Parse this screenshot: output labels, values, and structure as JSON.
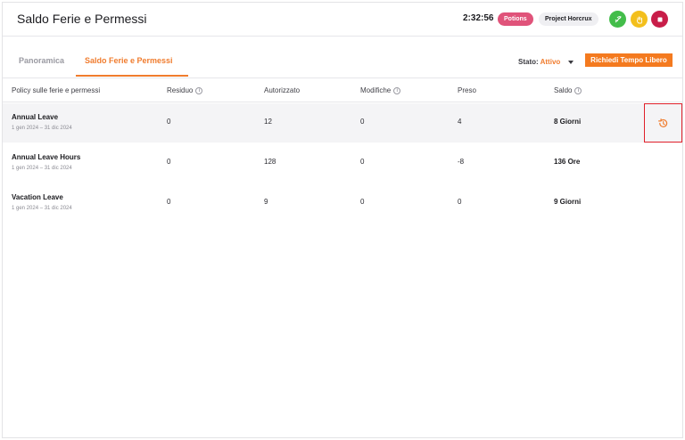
{
  "header": {
    "title": "Saldo Ferie e Permessi",
    "timer": "2:32:56",
    "badge_potions": "Potions",
    "badge_project": "Project Horcrux"
  },
  "tabs": [
    {
      "label": "Panoramica"
    },
    {
      "label": "Saldo Ferie e Permessi"
    }
  ],
  "filters": {
    "stato_label": "Stato:",
    "stato_value": "Attivo",
    "request_button": "Richiedi Tempo Libero"
  },
  "table": {
    "columns": [
      "Policy sulle ferie e permessi",
      "Residuo",
      "Autorizzato",
      "Modifiche",
      "Preso",
      "Saldo"
    ],
    "info_symbol": "i",
    "rows": [
      {
        "name": "Annual Leave",
        "dates": "1 gen 2024 – 31 dic 2024",
        "residuo": "0",
        "autorizzato": "12",
        "modifiche": "0",
        "preso": "4",
        "saldo": "8 Giorni"
      },
      {
        "name": "Annual Leave Hours",
        "dates": "1 gen 2024 – 31 dic 2024",
        "residuo": "0",
        "autorizzato": "128",
        "modifiche": "0",
        "preso": "-8",
        "saldo": "136 Ore"
      },
      {
        "name": "Vacation Leave",
        "dates": "1 gen 2024 – 31 dic 2024",
        "residuo": "0",
        "autorizzato": "9",
        "modifiche": "0",
        "preso": "0",
        "saldo": "9 Giorni"
      }
    ]
  },
  "colors": {
    "accent": "#f07c2e",
    "potions_badge": "#e0537a",
    "green_button": "#43bd4a",
    "yellow_button": "#f3bf1c",
    "red_button": "#c81d49",
    "highlight_box": "#e0202a"
  },
  "icons": [
    "sprout-icon",
    "hand-icon",
    "stop-icon",
    "history-icon",
    "info-icon",
    "caret-down-icon"
  ]
}
